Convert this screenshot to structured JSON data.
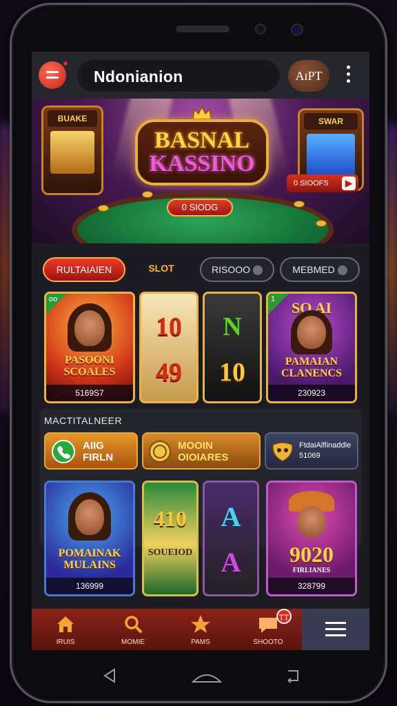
{
  "header": {
    "title": "Ndonianion",
    "account_label": "AɪPT",
    "more_icon": "kebab-menu-icon",
    "menu_icon": "hamburger-icon"
  },
  "banner": {
    "logo_line1": "BASNAL",
    "logo_line2": "KASSINO",
    "center_pill": "0 SIODG",
    "left_machine_label": "BUAKE",
    "right_machine_label": "SWAR",
    "right_pill": "0 SIOOFS"
  },
  "tabs": [
    {
      "label": "RULTAIAIEN"
    },
    {
      "label": "SLOT"
    },
    {
      "label": "RISOOO"
    },
    {
      "label": "MEBMED"
    }
  ],
  "games_row1": [
    {
      "title": "PASOONI SCOALES",
      "count": "5169S7",
      "badge": "oo"
    },
    {
      "title": "10 49",
      "top": "10",
      "bottom": "49"
    },
    {
      "title": "N 10",
      "top": "N",
      "bottom": "10"
    },
    {
      "title": "PAMAIAN CLANENCS",
      "count": "230923",
      "badge": "1",
      "header": "SO AI"
    }
  ],
  "section": {
    "label": "MACTITALNEER"
  },
  "features": [
    {
      "line1": "AIIG",
      "line2": "FIRLN"
    },
    {
      "line1": "MOOIN",
      "line2": "OIOIARES"
    },
    {
      "line1": "FtdaiAlflinaddle",
      "line2": "51069"
    }
  ],
  "games_row2": [
    {
      "title": "POMAINAK MULAINS",
      "count": "136999"
    },
    {
      "title": "410",
      "sub": "SOUEIOD"
    },
    {
      "title": "A A"
    },
    {
      "title": "9020",
      "sub": "FIRLIANES",
      "count": "328799"
    }
  ],
  "bottom_nav": [
    {
      "label": "IRUIS",
      "icon": "home-icon"
    },
    {
      "label": "MOMIE",
      "icon": "search-icon"
    },
    {
      "label": "PAMS",
      "icon": "star-icon"
    },
    {
      "label": "SHOOTO",
      "icon": "chat-icon",
      "badge": "TT"
    },
    {
      "label": "",
      "icon": "menu-lines-icon"
    }
  ],
  "colors": {
    "accent_red": "#e0301f",
    "gold": "#e7b34a",
    "screen_bg": "#1c1c22"
  }
}
